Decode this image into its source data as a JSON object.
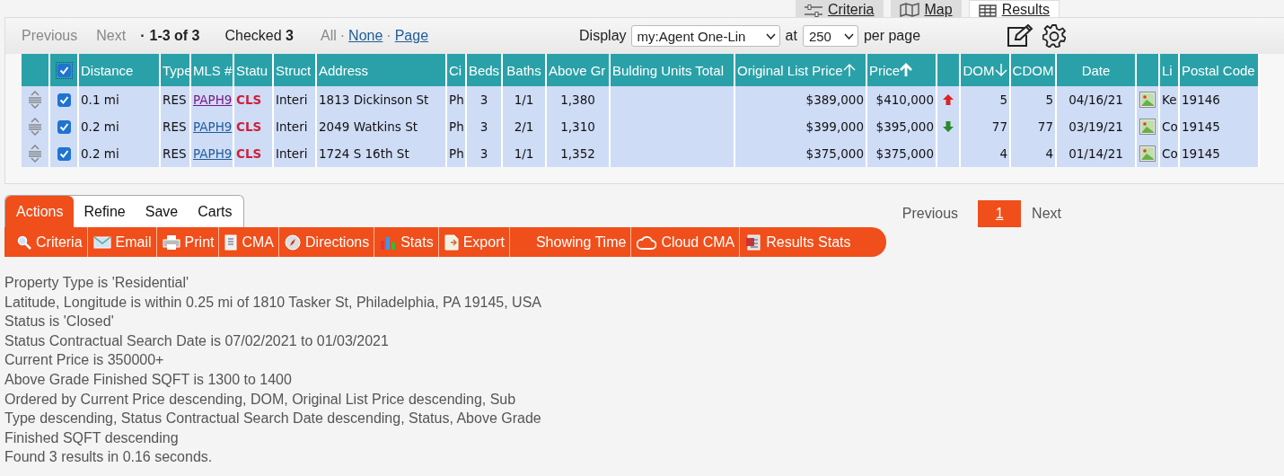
{
  "view_tabs": [
    {
      "label": "Criteria",
      "selected": false
    },
    {
      "label": "Map",
      "selected": false
    },
    {
      "label": "Results",
      "selected": true
    }
  ],
  "toolbar": {
    "previous": "Previous",
    "next": "Next",
    "separator_0": "·",
    "range": "1-3 of 3",
    "checked": "Checked **3**",
    "all": "All",
    "separator_1": "·",
    "none": "None",
    "separator_2": "·",
    "page": "Page",
    "display_label": "Display",
    "display_value": "my:Agent One-Lin",
    "at_label": "at",
    "per_page_value": "250",
    "per_page_label": "per page"
  },
  "table": {
    "select_all_checked": true,
    "columns": [
      {
        "label": "Distance"
      },
      {
        "label": "Type"
      },
      {
        "label": "MLS #"
      },
      {
        "label": "Statu"
      },
      {
        "label": "Struct"
      },
      {
        "label": "Address"
      },
      {
        "label": "Ci"
      },
      {
        "label": "Beds"
      },
      {
        "label": "Baths"
      },
      {
        "label": "Above Gr"
      },
      {
        "label": "Bulding Units Total"
      },
      {
        "label": "Original List Price",
        "sorted": true,
        "descending": false,
        "primary": false
      },
      {
        "label": "Price",
        "sorted": true,
        "descending": false,
        "primary": true
      },
      {
        "label": "DOM",
        "sorted": true,
        "descending": true,
        "primary": false
      },
      {
        "label": "CDOM"
      },
      {
        "label": "Date"
      },
      {
        "label": "Li"
      },
      {
        "label": "Postal Code"
      }
    ],
    "rows": [
      {
        "checked": true,
        "distance": "0.1 mi",
        "type": "RES",
        "mls": "PAPH9",
        "mls_visited": true,
        "status": "CLS",
        "struct": "Interi",
        "address": "1813 Dickinson St",
        "column_7": "Ph",
        "beds": "3",
        "baths": "1/1",
        "above_grade": "1,380",
        "original_list_price": "$389,000",
        "price": "$410,000",
        "price_up": true,
        "price_down": false,
        "dom": "5",
        "cdom": "5",
        "date": "04/16/21",
        "column_17": "Ke",
        "postal_code": "19146"
      },
      {
        "checked": true,
        "distance": "0.2 mi",
        "type": "RES",
        "mls": "PAPH9",
        "mls_visited": false,
        "status": "CLS",
        "struct": "Interi",
        "address": "2049 Watkins St",
        "column_7": "Ph",
        "beds": "3",
        "baths": "2/1",
        "above_grade": "1,310",
        "original_list_price": "$399,000",
        "price": "$395,000",
        "price_up": false,
        "price_down": true,
        "dom": "77",
        "cdom": "77",
        "date": "03/19/21",
        "column_17": "Co",
        "postal_code": "19145"
      },
      {
        "checked": true,
        "distance": "0.2 mi",
        "type": "RES",
        "mls": "PAPH9",
        "mls_visited": false,
        "status": "CLS",
        "struct": "Interi",
        "address": "1724 S 16th St",
        "column_7": "Ph",
        "beds": "3",
        "baths": "1/1",
        "above_grade": "1,352",
        "original_list_price": "$375,000",
        "price": "$375,000",
        "price_up": false,
        "price_down": false,
        "dom": "4",
        "cdom": "4",
        "date": "01/14/21",
        "column_17": "Co",
        "postal_code": "19145"
      }
    ]
  },
  "action_tabs": [
    {
      "label": "Actions",
      "selected": true
    },
    {
      "label": "Refine",
      "selected": false
    },
    {
      "label": "Save",
      "selected": false
    },
    {
      "label": "Carts",
      "selected": false
    }
  ],
  "actions": [
    "Criteria",
    "Email",
    "Print",
    "CMA",
    "Directions",
    "Stats",
    "Export",
    "Showing Time",
    "Cloud CMA",
    "Results Stats"
  ],
  "pagination": {
    "previous": "Previous",
    "pages": [
      {
        "label": "1",
        "selected": true
      }
    ],
    "next": "Next"
  },
  "criteria": [
    "Property Type is 'Residential'",
    "Latitude, Longitude is within 0.25 mi of 1810 Tasker St, Philadelphia, PA 19145, USA",
    "Status is 'Closed'",
    "Status Contractual Search Date is 07/02/2021 to 01/03/2021",
    "Current Price is 350000+",
    "Above Grade Finished SQFT is 1300 to 1400",
    "Ordered by Current Price descending, DOM, Original List Price descending, Sub Type descending, Status Contractual Search Date descending, Status, Above Grade Finished SQFT descending",
    "Found 3 results in 0.16 seconds."
  ]
}
